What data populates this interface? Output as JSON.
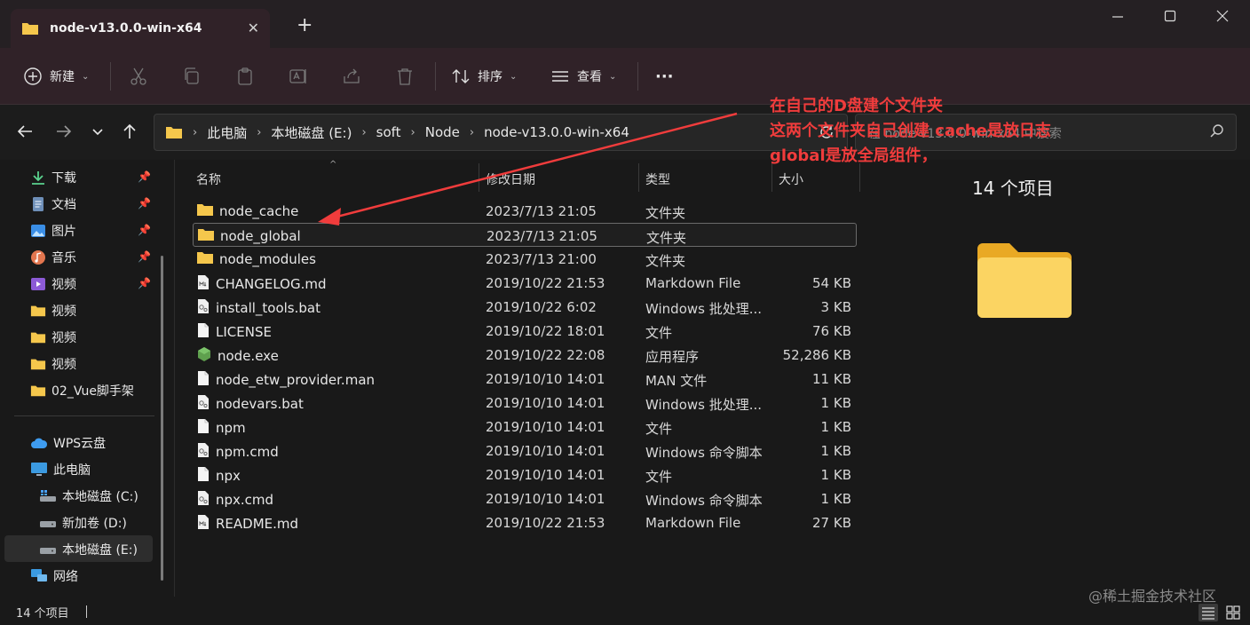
{
  "window": {
    "tab_title": "node-v13.0.0-win-x64",
    "new_tab_label": "+",
    "close_tab_label": "✕"
  },
  "toolbar": {
    "new_label": "新建",
    "sort_label": "排序",
    "view_label": "查看",
    "more_label": "···"
  },
  "address": {
    "crumbs": [
      "此电脑",
      "本地磁盘 (E:)",
      "soft",
      "Node",
      "node-v13.0.0-win-x64"
    ],
    "search_placeholder": "在 node-v13.0.0-win-x64 中搜索"
  },
  "sidebar": {
    "quick": [
      {
        "label": "下载",
        "icon": "download-icon",
        "pinned": true
      },
      {
        "label": "文档",
        "icon": "document-icon",
        "pinned": true
      },
      {
        "label": "图片",
        "icon": "picture-icon",
        "pinned": true
      },
      {
        "label": "音乐",
        "icon": "music-icon",
        "pinned": true
      },
      {
        "label": "视频",
        "icon": "video-icon",
        "pinned": true
      },
      {
        "label": "视频",
        "icon": "folder-icon",
        "pinned": false
      },
      {
        "label": "视频",
        "icon": "folder-icon",
        "pinned": false
      },
      {
        "label": "视频",
        "icon": "folder-icon",
        "pinned": false
      },
      {
        "label": "02_Vue脚手架",
        "icon": "folder-icon",
        "pinned": false
      }
    ],
    "wps": "WPS云盘",
    "this_pc": "此电脑",
    "drives": [
      "本地磁盘 (C:)",
      "新加卷 (D:)",
      "本地磁盘 (E:)"
    ],
    "network": "网络"
  },
  "columns": {
    "name": "名称",
    "date": "修改日期",
    "type": "类型",
    "size": "大小"
  },
  "files": [
    {
      "name": "node_cache",
      "date": "2023/7/13 21:05",
      "type": "文件夹",
      "size": "",
      "icon": "folder-icon"
    },
    {
      "name": "node_global",
      "date": "2023/7/13 21:05",
      "type": "文件夹",
      "size": "",
      "icon": "folder-icon"
    },
    {
      "name": "node_modules",
      "date": "2023/7/13 21:00",
      "type": "文件夹",
      "size": "",
      "icon": "folder-icon"
    },
    {
      "name": "CHANGELOG.md",
      "date": "2019/10/22 21:53",
      "type": "Markdown File",
      "size": "54 KB",
      "icon": "markdown-file-icon"
    },
    {
      "name": "install_tools.bat",
      "date": "2019/10/22 6:02",
      "type": "Windows 批处理...",
      "size": "3 KB",
      "icon": "batch-file-icon"
    },
    {
      "name": "LICENSE",
      "date": "2019/10/22 18:01",
      "type": "文件",
      "size": "76 KB",
      "icon": "file-icon"
    },
    {
      "name": "node.exe",
      "date": "2019/10/22 22:08",
      "type": "应用程序",
      "size": "52,286 KB",
      "icon": "node-exe-icon"
    },
    {
      "name": "node_etw_provider.man",
      "date": "2019/10/10 14:01",
      "type": "MAN 文件",
      "size": "11 KB",
      "icon": "file-icon"
    },
    {
      "name": "nodevars.bat",
      "date": "2019/10/10 14:01",
      "type": "Windows 批处理...",
      "size": "1 KB",
      "icon": "batch-file-icon"
    },
    {
      "name": "npm",
      "date": "2019/10/10 14:01",
      "type": "文件",
      "size": "1 KB",
      "icon": "file-icon"
    },
    {
      "name": "npm.cmd",
      "date": "2019/10/10 14:01",
      "type": "Windows 命令脚本",
      "size": "1 KB",
      "icon": "batch-file-icon"
    },
    {
      "name": "npx",
      "date": "2019/10/10 14:01",
      "type": "文件",
      "size": "1 KB",
      "icon": "file-icon"
    },
    {
      "name": "npx.cmd",
      "date": "2019/10/10 14:01",
      "type": "Windows 命令脚本",
      "size": "1 KB",
      "icon": "batch-file-icon"
    },
    {
      "name": "README.md",
      "date": "2019/10/22 21:53",
      "type": "Markdown File",
      "size": "27 KB",
      "icon": "markdown-file-icon"
    }
  ],
  "details": {
    "count": "14 个项目"
  },
  "status": {
    "count": "14 个项目"
  },
  "annotation": {
    "line1": "在自己的D盘建个文件夹",
    "line2": "这两个文件夹自己创建 cache是放日志",
    "line3": "global是放全局组件，"
  },
  "watermark": "@稀土掘金技术社区",
  "colors": {
    "folder": "#f5c74c",
    "annotation": "#f03c3c",
    "accent": "#4cc2ff"
  }
}
